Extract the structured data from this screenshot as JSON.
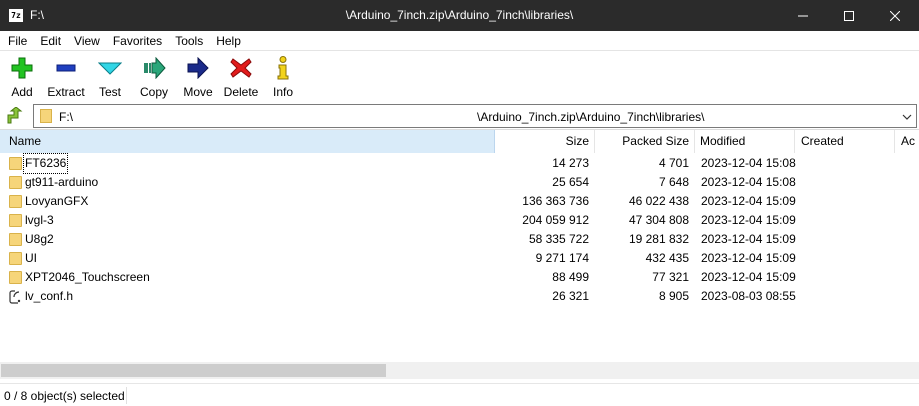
{
  "window": {
    "title_left": "F:\\",
    "title_center": "\\Arduino_7inch.zip\\Arduino_7inch\\libraries\\",
    "app_icon_text": "7z"
  },
  "menu": [
    "File",
    "Edit",
    "View",
    "Favorites",
    "Tools",
    "Help"
  ],
  "toolbar": [
    {
      "label": "Add",
      "icon": "add-icon"
    },
    {
      "label": "Extract",
      "icon": "extract-icon"
    },
    {
      "label": "Test",
      "icon": "test-icon"
    },
    {
      "label": "Copy",
      "icon": "copy-icon"
    },
    {
      "label": "Move",
      "icon": "move-icon"
    },
    {
      "label": "Delete",
      "icon": "delete-icon"
    },
    {
      "label": "Info",
      "icon": "info-icon"
    }
  ],
  "address": {
    "prefix": "F:\\",
    "path": "\\Arduino_7inch.zip\\Arduino_7inch\\libraries\\"
  },
  "columns": {
    "name": "Name",
    "size": "Size",
    "packed": "Packed Size",
    "modified": "Modified",
    "created": "Created",
    "accessed": "Ac"
  },
  "files": [
    {
      "name": "FT6236",
      "size": "14 273",
      "packed": "4 701",
      "modified": "2023-12-04 15:08",
      "type": "folder"
    },
    {
      "name": "gt911-arduino",
      "size": "25 654",
      "packed": "7 648",
      "modified": "2023-12-04 15:08",
      "type": "folder"
    },
    {
      "name": "LovyanGFX",
      "size": "136 363 736",
      "packed": "46 022 438",
      "modified": "2023-12-04 15:09",
      "type": "folder"
    },
    {
      "name": "lvgl-3",
      "size": "204 059 912",
      "packed": "47 304 808",
      "modified": "2023-12-04 15:09",
      "type": "folder"
    },
    {
      "name": "U8g2",
      "size": "58 335 722",
      "packed": "19 281 832",
      "modified": "2023-12-04 15:09",
      "type": "folder"
    },
    {
      "name": "UI",
      "size": "9 271 174",
      "packed": "432 435",
      "modified": "2023-12-04 15:09",
      "type": "folder"
    },
    {
      "name": "XPT2046_Touchscreen",
      "size": "88 499",
      "packed": "77 321",
      "modified": "2023-12-04 15:09",
      "type": "folder"
    },
    {
      "name": "lv_conf.h",
      "size": "26 321",
      "packed": "8 905",
      "modified": "2023-08-03 08:55",
      "type": "file"
    }
  ],
  "status": {
    "selection": "0 / 8 object(s) selected"
  },
  "colors": {
    "titlebar": "#2b2b2b",
    "folder": "#f6d57a",
    "header_selected": "#d9ebf9"
  }
}
